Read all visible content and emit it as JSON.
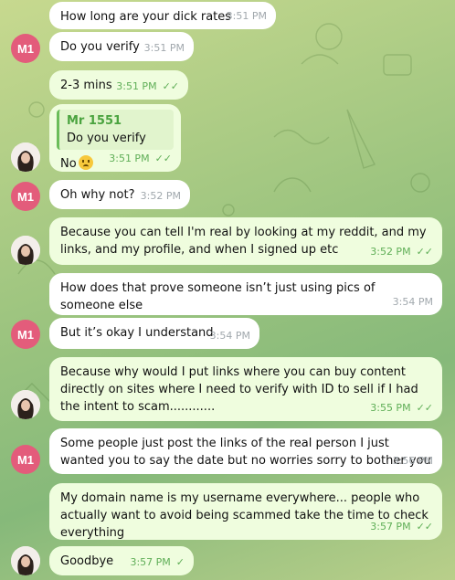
{
  "messages": [
    {
      "text": "How long are your dick rates",
      "time": "3:51 PM"
    },
    {
      "text": "Do you verify",
      "time": "3:51 PM"
    },
    {
      "text": "2-3 mins",
      "time": "3:51 PM"
    },
    {
      "reply_name": "Mr 1551",
      "reply_text": "Do you verify",
      "text": "No",
      "time": "3:51 PM"
    },
    {
      "text": "Oh why not?",
      "time": "3:52 PM"
    },
    {
      "text": "Because you can tell I'm real by looking at my reddit, and my links, and my profile, and when I signed up etc",
      "time": "3:52 PM"
    },
    {
      "text": "How does that prove someone isn’t just using pics of someone else",
      "time": "3:54 PM"
    },
    {
      "text": "But it’s okay I understand",
      "time": "3:54 PM"
    },
    {
      "text": "Because why would I put links where you can buy content directly on sites where I need to verify with ID to sell if I had the intent to scam............",
      "time": "3:55 PM"
    },
    {
      "text": "Some people just post the links of the real person I just wanted you to say the date but no worries sorry to bother you",
      "time": "3:56 PM"
    },
    {
      "text": "My domain name is my username everywhere... people who actually want to avoid being scammed take the time to check everything",
      "time": "3:57 PM"
    },
    {
      "text": "Goodbye",
      "time": "3:57 PM"
    }
  ],
  "avatars": {
    "m1_initials": "M1"
  },
  "ticks": {
    "read": "✓✓",
    "sent": "✓"
  },
  "colors": {
    "incoming_bubble": "#ffffff",
    "outgoing_bubble": "#effdde",
    "m1_avatar": "#e35c7b",
    "tick_green": "#5fae57"
  }
}
